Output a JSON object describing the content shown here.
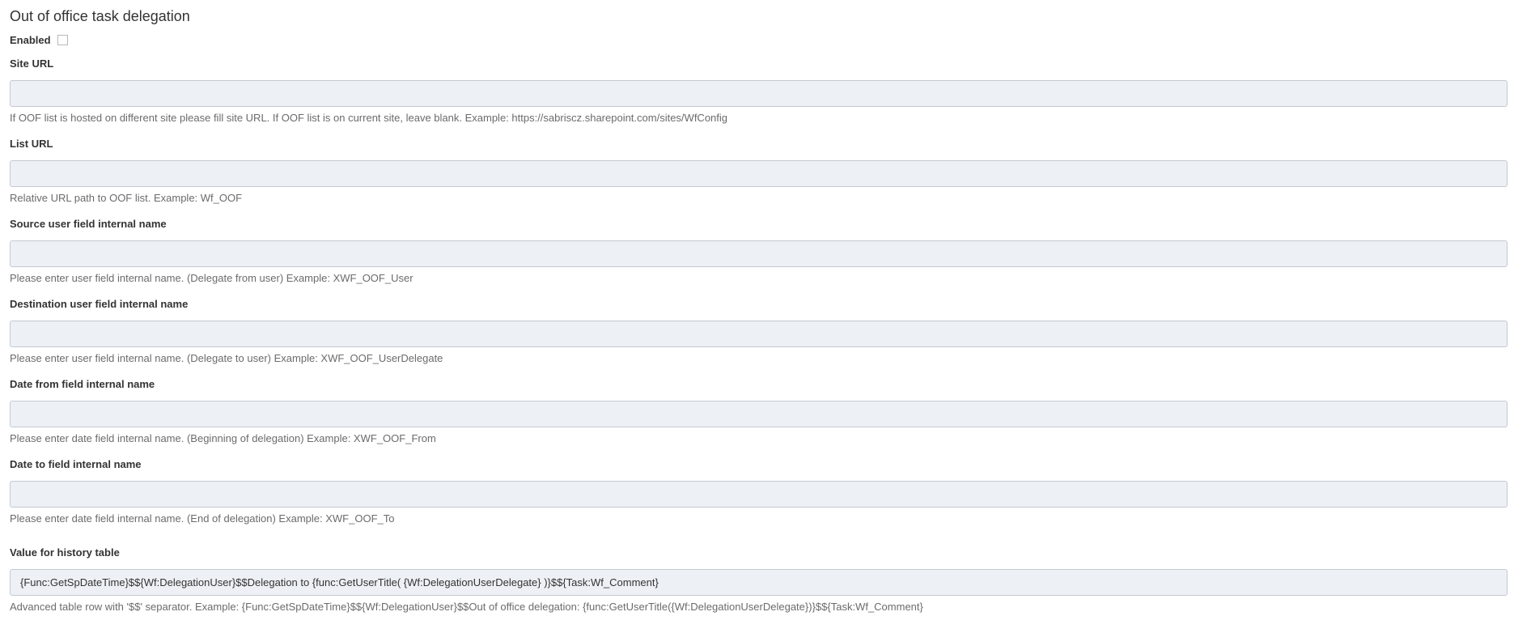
{
  "page": {
    "title": "Out of office task delegation"
  },
  "enabled": {
    "label": "Enabled",
    "checked": false
  },
  "fields": [
    {
      "label": "Site URL",
      "value": "",
      "help": "If OOF list is hosted on different site please fill site URL. If OOF list is on current site, leave blank. Example: https://sabriscz.sharepoint.com/sites/WfConfig"
    },
    {
      "label": "List URL",
      "value": "",
      "help": "Relative URL path to OOF list. Example: Wf_OOF"
    },
    {
      "label": "Source user field internal name",
      "value": "",
      "help": "Please enter user field internal name. (Delegate from user) Example: XWF_OOF_User"
    },
    {
      "label": "Destination user field internal name",
      "value": "",
      "help": "Please enter user field internal name. (Delegate to user) Example: XWF_OOF_UserDelegate"
    },
    {
      "label": "Date from field internal name",
      "value": "",
      "help": "Please enter date field internal name. (Beginning of delegation) Example: XWF_OOF_From"
    },
    {
      "label": "Date to field internal name",
      "value": "",
      "help": "Please enter date field internal name. (End of delegation) Example: XWF_OOF_To"
    },
    {
      "label": "Value for history table",
      "value": "{Func:GetSpDateTime}$${Wf:DelegationUser}$$Delegation to {func:GetUserTitle( {Wf:DelegationUserDelegate} )}$${Task:Wf_Comment}",
      "help": "Advanced table row with '$$' separator. Example: {Func:GetSpDateTime}$${Wf:DelegationUser}$$Out of office delegation: {func:GetUserTitle({Wf:DelegationUserDelegate})}$${Task:Wf_Comment}"
    }
  ]
}
